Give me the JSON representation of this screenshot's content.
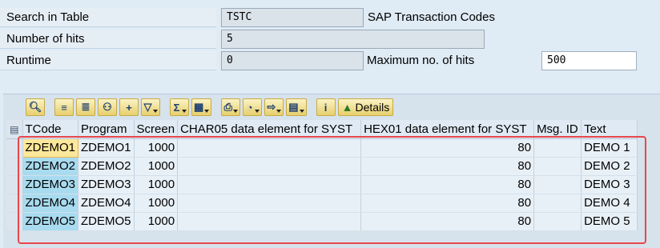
{
  "header": {
    "search_label": "Search in Table",
    "search_value": "TSTC",
    "search_description": "SAP Transaction Codes",
    "hits_label": "Number of hits",
    "hits_value": "5",
    "runtime_label": "Runtime",
    "runtime_value": "0",
    "max_hits_label": "Maximum no. of hits",
    "max_hits_value": "500"
  },
  "toolbar": {
    "details_label": "Details",
    "buttons": [
      "display-icon",
      "sort-ascending-icon",
      "sort-descending-icon",
      "find-icon",
      "find-next-icon",
      "filter-icon",
      "total-icon",
      "subtotal-icon",
      "print-icon",
      "views-icon",
      "export-icon",
      "layout-icon",
      "info-icon",
      "details-icon"
    ]
  },
  "table": {
    "columns": [
      "TCode",
      "Program",
      "Screen",
      "CHAR05 data element for SYST",
      "HEX01 data element for SYST",
      "Msg. ID",
      "Text"
    ],
    "rows": [
      {
        "tcode": "ZDEMO1",
        "program": "ZDEMO1",
        "screen": "1000",
        "char05": "",
        "hex01": "80",
        "msg_id": "",
        "text": "DEMO 1"
      },
      {
        "tcode": "ZDEMO2",
        "program": "ZDEMO2",
        "screen": "1000",
        "char05": "",
        "hex01": "80",
        "msg_id": "",
        "text": "DEMO 2"
      },
      {
        "tcode": "ZDEMO3",
        "program": "ZDEMO3",
        "screen": "1000",
        "char05": "",
        "hex01": "80",
        "msg_id": "",
        "text": "DEMO 3"
      },
      {
        "tcode": "ZDEMO4",
        "program": "ZDEMO4",
        "screen": "1000",
        "char05": "",
        "hex01": "80",
        "msg_id": "",
        "text": "DEMO 4"
      },
      {
        "tcode": "ZDEMO5",
        "program": "ZDEMO5",
        "screen": "1000",
        "char05": "",
        "hex01": "80",
        "msg_id": "",
        "text": "DEMO 5"
      }
    ]
  },
  "colors": {
    "background": "#dfebf5",
    "key_column": "#a8dbef",
    "selected_cell": "#fde79a",
    "highlight_border": "#e8474b"
  }
}
